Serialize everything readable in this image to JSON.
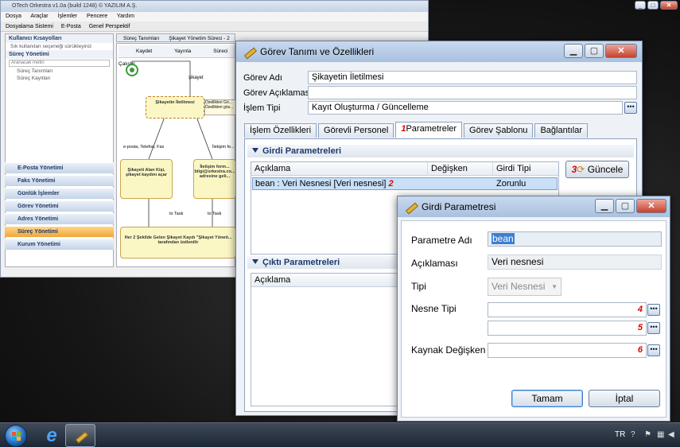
{
  "back_window": {
    "title": "OTech Orkestra v1.0a (build 1248) © YAZILIM A.Ş.",
    "menu": [
      "Dosya",
      "Araçlar",
      "İşlemler",
      "Pencere",
      "Yardım"
    ],
    "toolbar": [
      "Dosyalama Sistemi",
      "E-Posta",
      "Genel Perspektif"
    ],
    "left_panel": {
      "shortcuts_header": "Kullanıcı Kısayolları",
      "shortcuts_hint": "Sık kullanılan seçeneği sürükleyiniz",
      "process_header": "Süreç Yönetimi",
      "search_placeholder": "Aranacak metin",
      "tree": [
        "Süreç Tanımları",
        "Süreç Kayıtları"
      ]
    },
    "nav_items": [
      "E-Posta Yönetimi",
      "Faks Yönetimi",
      "Günlük İşlemler",
      "Görev Yönetimi",
      "Adres Yönetimi",
      "Süreç Yönetimi",
      "Kurum Yönetimi"
    ],
    "editor_tabs": [
      "Süreç Tanımları",
      "Şikayet Yönetim Süreci - 2"
    ],
    "editor_toolbar": [
      "Kaydet",
      "Yayınla",
      "Süreci Çalıştır"
    ],
    "diagram": {
      "edge_top": "şikayet",
      "node_main": "Şikayetin İletilmesi",
      "tooltip": "Özellikleri Gö... Özellikleri gös...",
      "edge_left": "e-posta, Telefon, Fax",
      "edge_right": "İletişim fo...",
      "node_left": "Şikayeti Alan Kişi, şikayet kaydını açar",
      "node_right": "İletişim form... bilgi@orkestra.co... adresine geli...",
      "to_task_1": "to Task",
      "to_task_2": "to Task",
      "node_bottom": "Her 2 Şekilde Gelen Şikayet Kaydı \"Şikayet Yöneti... tarafından üstlenilir"
    }
  },
  "main_dialog": {
    "title": "Görev Tanımı ve Özellikleri",
    "gorev_adi_label": "Görev Adı",
    "gorev_adi_value": "Şikayetin İletilmesi",
    "gorev_aciklamasi_label": "Görev Açıklaması",
    "gorev_aciklamasi_value": "",
    "islem_tipi_label": "İşlem Tipi",
    "islem_tipi_value": "Kayıt Oluşturma / Güncelleme",
    "tabs": [
      "İşlem Özellikleri",
      "Görevli Personel",
      "Parametreler",
      "Görev Şablonu",
      "Bağlantılar"
    ],
    "tab_marker": "1",
    "girdi_header": "Girdi Parametreleri",
    "girdi_columns": [
      "Açıklama",
      "Değişken",
      "Girdi Tipi"
    ],
    "girdi_row": {
      "aciklama": "bean : Veri Nesnesi [Veri nesnesi]",
      "marker": "2",
      "degisken": "",
      "tip": "Zorunlu"
    },
    "guncelle_marker": "3",
    "guncelle_label": "Güncele",
    "cikti_header": "Çıktı Parametreleri",
    "cikti_columns": [
      "Açıklama"
    ]
  },
  "girdi_dialog": {
    "title": "Girdi Parametresi",
    "parametre_adi_label": "Parametre Adı",
    "parametre_adi_value": "bean",
    "aciklamasi_label": "Açıklaması",
    "aciklamasi_value": "Veri nesnesi",
    "tipi_label": "Tipi",
    "tipi_value": "Veri Nesnesi",
    "nesne_tipi_label": "Nesne Tipi",
    "kaynak_label": "Kaynak Değişken",
    "marker_4": "4",
    "marker_5": "5",
    "marker_6": "6",
    "ok_label": "Tamam",
    "cancel_label": "İptal"
  },
  "taskbar": {
    "language": "TR"
  },
  "colors": {
    "accent": "#3c7fd0",
    "marker": "#dd0000",
    "selection": "#c9e0f7"
  }
}
